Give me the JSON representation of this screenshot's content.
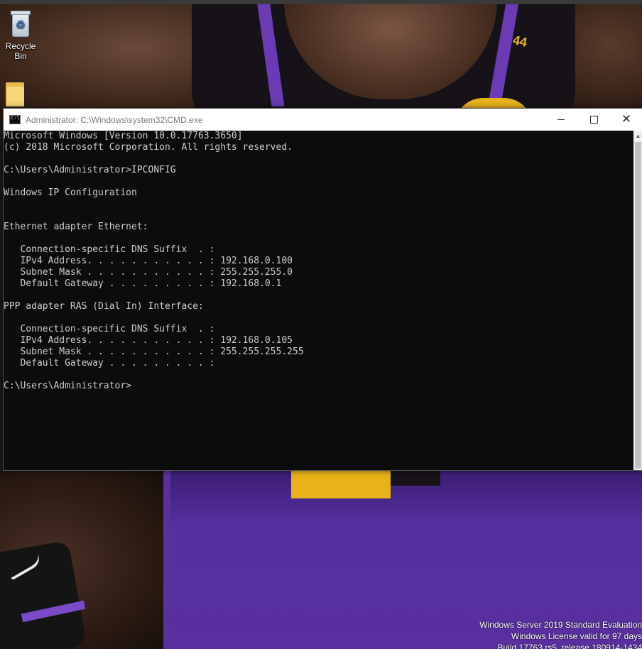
{
  "desktop": {
    "icons": [
      {
        "label": "Recycle Bin",
        "icon": "recycle-bin-icon"
      },
      {
        "label": "",
        "icon": "folder-icon"
      }
    ],
    "wallpaper": "basketball-player-purple-jersey",
    "jersey_number": "44"
  },
  "window": {
    "title": "Administrator: C:\\Windows\\system32\\CMD.exe",
    "icon": "cmd-icon",
    "controls": {
      "minimize": "minimize-icon",
      "maximize": "maximize-icon",
      "close": "close-icon"
    }
  },
  "console": {
    "lines": [
      "Microsoft Windows [Version 10.0.17763.3650]",
      "(c) 2018 Microsoft Corporation. All rights reserved.",
      "",
      "C:\\Users\\Administrator>IPCONFIG",
      "",
      "Windows IP Configuration",
      "",
      "",
      "Ethernet adapter Ethernet:",
      "",
      "   Connection-specific DNS Suffix  . :",
      "   IPv4 Address. . . . . . . . . . . : 192.168.0.100",
      "   Subnet Mask . . . . . . . . . . . : 255.255.255.0",
      "   Default Gateway . . . . . . . . . : 192.168.0.1",
      "",
      "PPP adapter RAS (Dial In) Interface:",
      "",
      "   Connection-specific DNS Suffix  . :",
      "   IPv4 Address. . . . . . . . . . . : 192.168.0.105",
      "   Subnet Mask . . . . . . . . . . . : 255.255.255.255",
      "   Default Gateway . . . . . . . . . :",
      "",
      "C:\\Users\\Administrator>"
    ]
  },
  "watermark": {
    "line1": "Windows Server 2019 Standard Evaluation",
    "line2": "Windows License valid for 97 days",
    "line3": "Build 17763.rs5_release.180914-1434"
  },
  "colors": {
    "console_bg": "#0c0c0c",
    "console_fg": "#cccccc",
    "titlebar_bg": "#ffffff",
    "jersey_purple": "#5a2fa0",
    "jersey_gold": "#e8b318"
  }
}
